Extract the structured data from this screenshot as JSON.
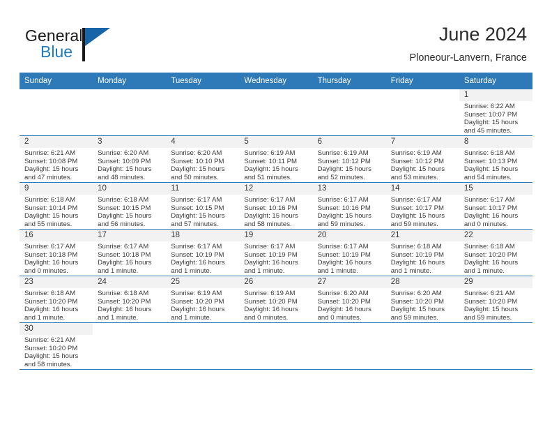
{
  "brand": {
    "name_top": "General",
    "name_bottom": "Blue",
    "triangle_color": "#1765a8",
    "blue_color": "#1f7ac4"
  },
  "header": {
    "title": "June 2024",
    "subtitle": "Ploneour-Lanvern, France",
    "header_bg": "#2e7ab8",
    "band_bg": "#f2f2f2"
  },
  "weekdays": [
    "Sunday",
    "Monday",
    "Tuesday",
    "Wednesday",
    "Thursday",
    "Friday",
    "Saturday"
  ],
  "labels": {
    "sunrise_prefix": "Sunrise:",
    "sunset_prefix": "Sunset:",
    "daylight_prefix": "Daylight:"
  },
  "weeks": [
    [
      {
        "day": "",
        "blank": true
      },
      {
        "day": "",
        "blank": true
      },
      {
        "day": "",
        "blank": true
      },
      {
        "day": "",
        "blank": true
      },
      {
        "day": "",
        "blank": true
      },
      {
        "day": "",
        "blank": true
      },
      {
        "day": "1",
        "sunrise": "Sunrise: 6:22 AM",
        "sunset": "Sunset: 10:07 PM",
        "daylight_line1": "Daylight: 15 hours",
        "daylight_line2": "and 45 minutes."
      }
    ],
    [
      {
        "day": "2",
        "sunrise": "Sunrise: 6:21 AM",
        "sunset": "Sunset: 10:08 PM",
        "daylight_line1": "Daylight: 15 hours",
        "daylight_line2": "and 47 minutes."
      },
      {
        "day": "3",
        "sunrise": "Sunrise: 6:20 AM",
        "sunset": "Sunset: 10:09 PM",
        "daylight_line1": "Daylight: 15 hours",
        "daylight_line2": "and 48 minutes."
      },
      {
        "day": "4",
        "sunrise": "Sunrise: 6:20 AM",
        "sunset": "Sunset: 10:10 PM",
        "daylight_line1": "Daylight: 15 hours",
        "daylight_line2": "and 50 minutes."
      },
      {
        "day": "5",
        "sunrise": "Sunrise: 6:19 AM",
        "sunset": "Sunset: 10:11 PM",
        "daylight_line1": "Daylight: 15 hours",
        "daylight_line2": "and 51 minutes."
      },
      {
        "day": "6",
        "sunrise": "Sunrise: 6:19 AM",
        "sunset": "Sunset: 10:12 PM",
        "daylight_line1": "Daylight: 15 hours",
        "daylight_line2": "and 52 minutes."
      },
      {
        "day": "7",
        "sunrise": "Sunrise: 6:19 AM",
        "sunset": "Sunset: 10:12 PM",
        "daylight_line1": "Daylight: 15 hours",
        "daylight_line2": "and 53 minutes."
      },
      {
        "day": "8",
        "sunrise": "Sunrise: 6:18 AM",
        "sunset": "Sunset: 10:13 PM",
        "daylight_line1": "Daylight: 15 hours",
        "daylight_line2": "and 54 minutes."
      }
    ],
    [
      {
        "day": "9",
        "sunrise": "Sunrise: 6:18 AM",
        "sunset": "Sunset: 10:14 PM",
        "daylight_line1": "Daylight: 15 hours",
        "daylight_line2": "and 55 minutes."
      },
      {
        "day": "10",
        "sunrise": "Sunrise: 6:18 AM",
        "sunset": "Sunset: 10:15 PM",
        "daylight_line1": "Daylight: 15 hours",
        "daylight_line2": "and 56 minutes."
      },
      {
        "day": "11",
        "sunrise": "Sunrise: 6:17 AM",
        "sunset": "Sunset: 10:15 PM",
        "daylight_line1": "Daylight: 15 hours",
        "daylight_line2": "and 57 minutes."
      },
      {
        "day": "12",
        "sunrise": "Sunrise: 6:17 AM",
        "sunset": "Sunset: 10:16 PM",
        "daylight_line1": "Daylight: 15 hours",
        "daylight_line2": "and 58 minutes."
      },
      {
        "day": "13",
        "sunrise": "Sunrise: 6:17 AM",
        "sunset": "Sunset: 10:16 PM",
        "daylight_line1": "Daylight: 15 hours",
        "daylight_line2": "and 59 minutes."
      },
      {
        "day": "14",
        "sunrise": "Sunrise: 6:17 AM",
        "sunset": "Sunset: 10:17 PM",
        "daylight_line1": "Daylight: 15 hours",
        "daylight_line2": "and 59 minutes."
      },
      {
        "day": "15",
        "sunrise": "Sunrise: 6:17 AM",
        "sunset": "Sunset: 10:17 PM",
        "daylight_line1": "Daylight: 16 hours",
        "daylight_line2": "and 0 minutes."
      }
    ],
    [
      {
        "day": "16",
        "sunrise": "Sunrise: 6:17 AM",
        "sunset": "Sunset: 10:18 PM",
        "daylight_line1": "Daylight: 16 hours",
        "daylight_line2": "and 0 minutes."
      },
      {
        "day": "17",
        "sunrise": "Sunrise: 6:17 AM",
        "sunset": "Sunset: 10:18 PM",
        "daylight_line1": "Daylight: 16 hours",
        "daylight_line2": "and 1 minute."
      },
      {
        "day": "18",
        "sunrise": "Sunrise: 6:17 AM",
        "sunset": "Sunset: 10:19 PM",
        "daylight_line1": "Daylight: 16 hours",
        "daylight_line2": "and 1 minute."
      },
      {
        "day": "19",
        "sunrise": "Sunrise: 6:17 AM",
        "sunset": "Sunset: 10:19 PM",
        "daylight_line1": "Daylight: 16 hours",
        "daylight_line2": "and 1 minute."
      },
      {
        "day": "20",
        "sunrise": "Sunrise: 6:17 AM",
        "sunset": "Sunset: 10:19 PM",
        "daylight_line1": "Daylight: 16 hours",
        "daylight_line2": "and 1 minute."
      },
      {
        "day": "21",
        "sunrise": "Sunrise: 6:18 AM",
        "sunset": "Sunset: 10:19 PM",
        "daylight_line1": "Daylight: 16 hours",
        "daylight_line2": "and 1 minute."
      },
      {
        "day": "22",
        "sunrise": "Sunrise: 6:18 AM",
        "sunset": "Sunset: 10:20 PM",
        "daylight_line1": "Daylight: 16 hours",
        "daylight_line2": "and 1 minute."
      }
    ],
    [
      {
        "day": "23",
        "sunrise": "Sunrise: 6:18 AM",
        "sunset": "Sunset: 10:20 PM",
        "daylight_line1": "Daylight: 16 hours",
        "daylight_line2": "and 1 minute."
      },
      {
        "day": "24",
        "sunrise": "Sunrise: 6:18 AM",
        "sunset": "Sunset: 10:20 PM",
        "daylight_line1": "Daylight: 16 hours",
        "daylight_line2": "and 1 minute."
      },
      {
        "day": "25",
        "sunrise": "Sunrise: 6:19 AM",
        "sunset": "Sunset: 10:20 PM",
        "daylight_line1": "Daylight: 16 hours",
        "daylight_line2": "and 1 minute."
      },
      {
        "day": "26",
        "sunrise": "Sunrise: 6:19 AM",
        "sunset": "Sunset: 10:20 PM",
        "daylight_line1": "Daylight: 16 hours",
        "daylight_line2": "and 0 minutes."
      },
      {
        "day": "27",
        "sunrise": "Sunrise: 6:20 AM",
        "sunset": "Sunset: 10:20 PM",
        "daylight_line1": "Daylight: 16 hours",
        "daylight_line2": "and 0 minutes."
      },
      {
        "day": "28",
        "sunrise": "Sunrise: 6:20 AM",
        "sunset": "Sunset: 10:20 PM",
        "daylight_line1": "Daylight: 15 hours",
        "daylight_line2": "and 59 minutes."
      },
      {
        "day": "29",
        "sunrise": "Sunrise: 6:21 AM",
        "sunset": "Sunset: 10:20 PM",
        "daylight_line1": "Daylight: 15 hours",
        "daylight_line2": "and 59 minutes."
      }
    ],
    [
      {
        "day": "30",
        "sunrise": "Sunrise: 6:21 AM",
        "sunset": "Sunset: 10:20 PM",
        "daylight_line1": "Daylight: 15 hours",
        "daylight_line2": "and 58 minutes."
      },
      {
        "day": "",
        "blank": true
      },
      {
        "day": "",
        "blank": true
      },
      {
        "day": "",
        "blank": true
      },
      {
        "day": "",
        "blank": true
      },
      {
        "day": "",
        "blank": true
      },
      {
        "day": "",
        "blank": true
      }
    ]
  ]
}
